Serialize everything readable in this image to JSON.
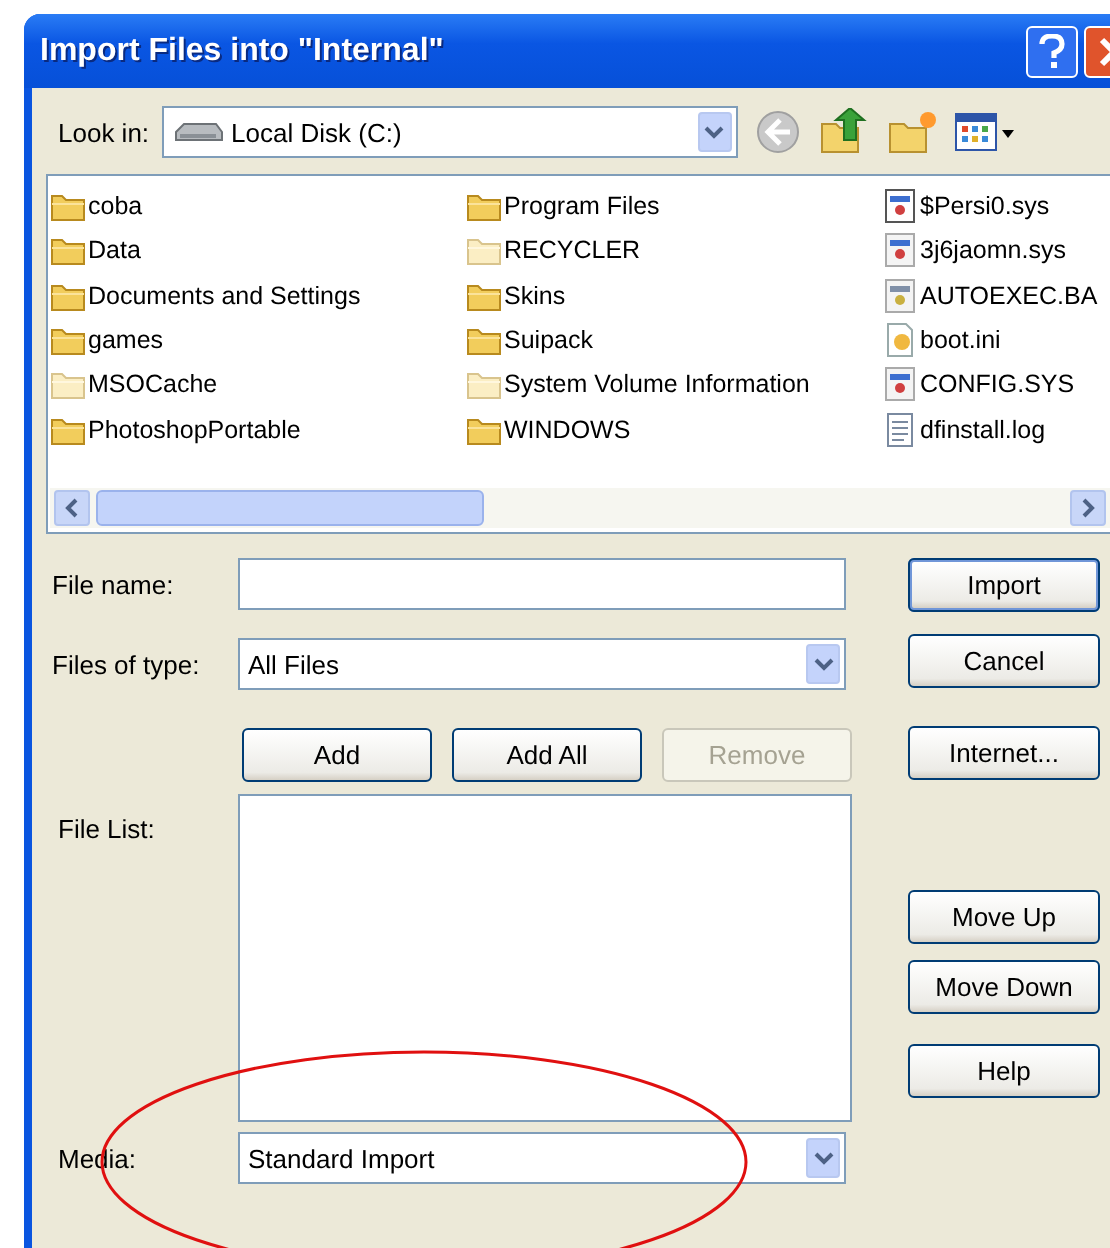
{
  "window": {
    "title": "Import Files into \"Internal\""
  },
  "look_in": {
    "label": "Look in:",
    "value": "Local Disk (C:)"
  },
  "files": [
    {
      "name": "coba",
      "kind": "folder"
    },
    {
      "name": "Data",
      "kind": "folder"
    },
    {
      "name": "Documents and Settings",
      "kind": "folder"
    },
    {
      "name": "games",
      "kind": "folder"
    },
    {
      "name": "MSOCache",
      "kind": "hidden-folder"
    },
    {
      "name": "PhotoshopPortable",
      "kind": "folder"
    },
    {
      "name": "Program Files",
      "kind": "folder"
    },
    {
      "name": "RECYCLER",
      "kind": "hidden-folder"
    },
    {
      "name": "Skins",
      "kind": "folder"
    },
    {
      "name": "Suipack",
      "kind": "folder"
    },
    {
      "name": "System Volume Information",
      "kind": "hidden-folder"
    },
    {
      "name": "WINDOWS",
      "kind": "folder"
    },
    {
      "name": "$Persi0.sys",
      "kind": "system-file"
    },
    {
      "name": "3j6jaomn.sys",
      "kind": "hidden-file"
    },
    {
      "name": "AUTOEXEC.BA",
      "kind": "batch-file"
    },
    {
      "name": "boot.ini",
      "kind": "ini-file"
    },
    {
      "name": "CONFIG.SYS",
      "kind": "hidden-file"
    },
    {
      "name": "dfinstall.log",
      "kind": "text-file"
    }
  ],
  "file_name": {
    "label": "File name:"
  },
  "files_of_type": {
    "label": "Files of type:",
    "value": "All Files"
  },
  "list_buttons": [
    {
      "label": "Add",
      "disabled": false
    },
    {
      "label": "Add All",
      "disabled": false
    },
    {
      "label": "Remove",
      "disabled": true
    }
  ],
  "file_list": {
    "label": "File List:"
  },
  "media": {
    "label": "Media:",
    "value": "Standard Import"
  },
  "side_buttons": [
    {
      "label": "Import",
      "default": true
    },
    {
      "label": "Cancel",
      "default": false
    },
    {
      "label": "Internet...",
      "default": false
    },
    {
      "label": "Move Up",
      "default": false
    },
    {
      "label": "Move Down",
      "default": false
    },
    {
      "label": "Help",
      "default": false
    }
  ]
}
